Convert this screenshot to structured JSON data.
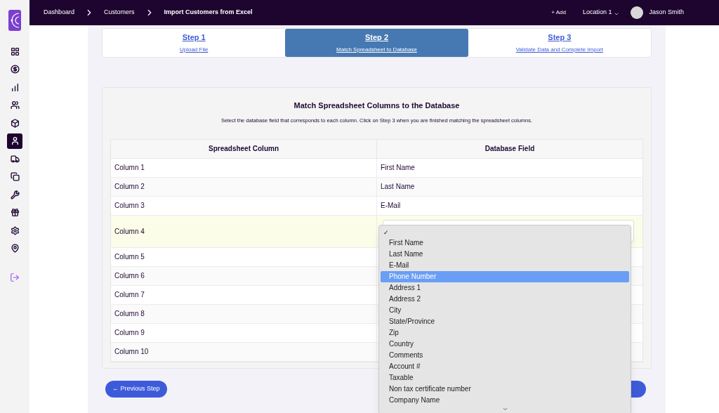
{
  "breadcrumbs": [
    "Dashboard",
    "Customers",
    "Import Customers from Excel"
  ],
  "topbar": {
    "add": "+ Add",
    "location": "Location 1",
    "user": "Jason Smith"
  },
  "sidebar": {
    "items": [
      {
        "selected": false
      },
      {
        "selected": false
      },
      {
        "selected": false
      },
      {
        "selected": false
      },
      {
        "selected": false
      },
      {
        "selected": true
      },
      {
        "selected": false
      },
      {
        "selected": false
      },
      {
        "selected": false
      },
      {
        "selected": false
      },
      {
        "selected": false
      },
      {
        "selected": false
      }
    ]
  },
  "steps": [
    {
      "title": "Step 1",
      "subtitle": "Upload File",
      "selected": false
    },
    {
      "title": "Step 2",
      "subtitle": "Match Spreadsheet to Database",
      "selected": true
    },
    {
      "title": "Step 3",
      "subtitle": "Validate Data and Complete Import",
      "selected": false
    }
  ],
  "card": {
    "title": "Match Spreadsheet Columns to the Database",
    "description": "Select the database field that corresponds to each column. Click on Step 3 when you are finished matching the spreadsheet columns."
  },
  "table": {
    "columns": [
      "Spreadsheet Column",
      "Database Field"
    ],
    "rows": [
      {
        "column": "Column 1",
        "field": "First Name",
        "kind": "text",
        "highlighted": false
      },
      {
        "column": "Column 2",
        "field": "Last Name",
        "kind": "text",
        "highlighted": false
      },
      {
        "column": "Column 3",
        "field": "E-Mail",
        "kind": "text",
        "highlighted": false
      },
      {
        "column": "Column 4",
        "kind": "select",
        "highlighted": true
      },
      {
        "column": "Column 5",
        "kind": "text",
        "highlighted": false
      },
      {
        "column": "Column 6",
        "kind": "text",
        "highlighted": false
      },
      {
        "column": "Column 7",
        "kind": "text",
        "highlighted": false
      },
      {
        "column": "Column 8",
        "kind": "text",
        "highlighted": false
      },
      {
        "column": "Column 9",
        "kind": "text",
        "highlighted": false
      },
      {
        "column": "Column 10",
        "kind": "text",
        "highlighted": false
      }
    ]
  },
  "dropdown": {
    "current_mark": "✓",
    "options": [
      {
        "label": "First Name",
        "selected": false
      },
      {
        "label": "Last Name",
        "selected": false
      },
      {
        "label": "E-Mail",
        "selected": false
      },
      {
        "label": "Phone Number",
        "selected": true
      },
      {
        "label": "Address 1",
        "selected": false
      },
      {
        "label": "Address 2",
        "selected": false
      },
      {
        "label": "City",
        "selected": false
      },
      {
        "label": "State/Province",
        "selected": false
      },
      {
        "label": "Zip",
        "selected": false
      },
      {
        "label": "Country",
        "selected": false
      },
      {
        "label": "Comments",
        "selected": false
      },
      {
        "label": "Account #",
        "selected": false
      },
      {
        "label": "Taxable",
        "selected": false
      },
      {
        "label": "Non tax certificate number",
        "selected": false
      },
      {
        "label": "Company Name",
        "selected": false
      }
    ]
  },
  "buttons": {
    "previous": "← Previous Step"
  }
}
